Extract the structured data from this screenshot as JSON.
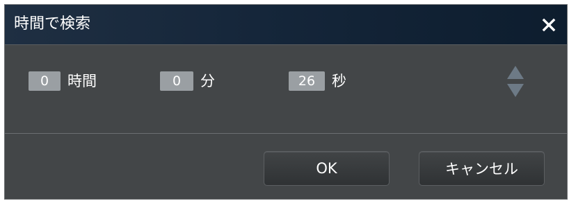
{
  "dialog": {
    "title": "時間で検索",
    "close_icon": "close-icon"
  },
  "time": {
    "hours": {
      "value": "0",
      "unit": "時間"
    },
    "minutes": {
      "value": "0",
      "unit": "分"
    },
    "seconds": {
      "value": "26",
      "unit": "秒"
    },
    "spinner_icons": [
      "spin-up-icon",
      "spin-down-icon"
    ]
  },
  "buttons": {
    "ok_label": "OK",
    "cancel_label": "キャンセル"
  },
  "colors": {
    "dialog_bg": "#434648",
    "titlebar_bg": "#15263a",
    "field_bg": "#9a9fa3",
    "spinner": "#6d7a86",
    "text": "#ffffff"
  }
}
